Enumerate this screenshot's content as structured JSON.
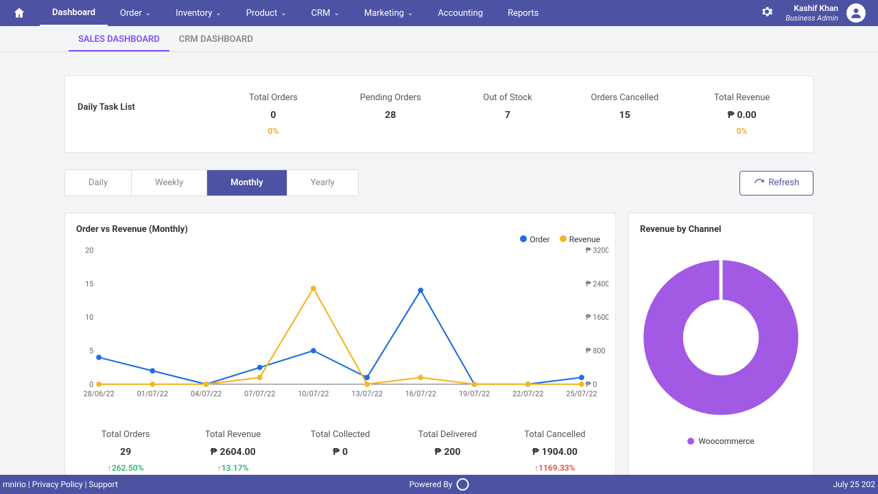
{
  "nav": {
    "items": [
      "Dashboard",
      "Order",
      "Inventory",
      "Product",
      "CRM",
      "Marketing",
      "Accounting",
      "Reports"
    ],
    "dropdown": [
      false,
      true,
      true,
      true,
      true,
      true,
      false,
      false
    ],
    "active": 0
  },
  "user": {
    "name": "Kashif Khan",
    "role": "Business Admin"
  },
  "tabs": {
    "items": [
      "SALES DASHBOARD",
      "CRM DASHBOARD"
    ],
    "active": 0
  },
  "daily": {
    "title": "Daily Task List",
    "stats": [
      {
        "label": "Total Orders",
        "value": "0",
        "pct": "0%"
      },
      {
        "label": "Pending Orders",
        "value": "28",
        "pct": ""
      },
      {
        "label": "Out of Stock",
        "value": "7",
        "pct": ""
      },
      {
        "label": "Orders Cancelled",
        "value": "15",
        "pct": ""
      },
      {
        "label": "Total Revenue",
        "value": "₱  0.00",
        "pct": "0%"
      }
    ]
  },
  "period": {
    "options": [
      "Daily",
      "Weekly",
      "Monthly",
      "Yearly"
    ],
    "active": 2,
    "refresh": "Refresh"
  },
  "line_chart": {
    "title": "Order vs Revenue (Monthly)",
    "legend": [
      "Order",
      "Revenue"
    ],
    "colors": {
      "order": "#1e6fe0",
      "revenue": "#f5b625"
    }
  },
  "chart_data": {
    "type": "line",
    "categories": [
      "28/06/22",
      "01/07/22",
      "04/07/22",
      "07/07/22",
      "10/07/22",
      "13/07/22",
      "16/07/22",
      "19/07/22",
      "22/07/22",
      "25/07/22"
    ],
    "series": [
      {
        "name": "Order",
        "values": [
          4,
          2,
          0,
          2.5,
          5,
          1,
          14,
          0,
          0,
          1
        ]
      },
      {
        "name": "Revenue",
        "values": [
          0,
          0,
          0,
          1,
          14.3,
          0,
          1,
          0,
          0,
          0
        ]
      }
    ],
    "ylabel": "",
    "ylim": [
      0,
      20
    ],
    "yticks": [
      0,
      5,
      10,
      15,
      20
    ],
    "y2lim": [
      0,
      3200
    ],
    "y2ticks": [
      "₱ 0",
      "₱ 800",
      "₱ 1600",
      "₱ 2400",
      "₱ 3200"
    ],
    "title": "Order vs Revenue (Monthly)"
  },
  "summary": [
    {
      "label": "Total Orders",
      "value": "29",
      "delta": "262.50%",
      "dir": "up"
    },
    {
      "label": "Total Revenue",
      "value": "₱  2604.00",
      "delta": "13.17%",
      "dir": "up"
    },
    {
      "label": "Total Collected",
      "value": "₱  0",
      "delta": "",
      "dir": ""
    },
    {
      "label": "Total Delivered",
      "value": "₱  200",
      "delta": "",
      "dir": ""
    },
    {
      "label": "Total Cancelled",
      "value": "₱  1904.00",
      "delta": "1169.33%",
      "dir": "down"
    }
  ],
  "donut": {
    "title": "Revenue by Channel",
    "legend": "Woocommerce",
    "color": "#a259e4"
  },
  "footer": {
    "left": "mnirio | Privacy Policy | Support",
    "center": "Powered By",
    "right": "July 25 202"
  }
}
